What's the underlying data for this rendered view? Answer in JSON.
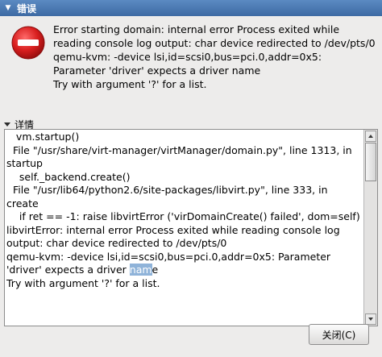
{
  "window": {
    "title": "错误",
    "menu_glyph": "▼"
  },
  "error": {
    "icon": "error-no-entry-icon",
    "message_lines": [
      "Error starting domain: internal error Process exited while",
      "reading console log output: char device redirected to /dev/pts/0",
      "qemu-kvm: -device lsi,id=scsi0,bus=pci.0,addr=0x5:",
      "Parameter 'driver' expects a driver name",
      "Try with argument '?' for a list."
    ]
  },
  "details": {
    "label": "详情",
    "lines": [
      "   vm.startup()",
      "  File \"/usr/share/virt-manager/virtManager/domain.py\", line 1313, in",
      "startup",
      "    self._backend.create()",
      "  File \"/usr/lib64/python2.6/site-packages/libvirt.py\", line 333, in",
      "create",
      "    if ret == -1: raise libvirtError ('virDomainCreate() failed', dom=self)",
      "libvirtError: internal error Process exited while reading console log",
      "output: char device redirected to /dev/pts/0",
      "qemu-kvm: -device lsi,id=scsi0,bus=pci.0,addr=0x5: Parameter",
      "'driver' expects a driver ",
      "Try with argument '?' for a list."
    ],
    "selected_text": "nam",
    "after_selection": "e"
  },
  "buttons": {
    "close": "关闭(C)"
  },
  "colors": {
    "title_bar": "#4a78b2",
    "selection": "#8fb3d9",
    "error_icon": "#d81e1e"
  }
}
